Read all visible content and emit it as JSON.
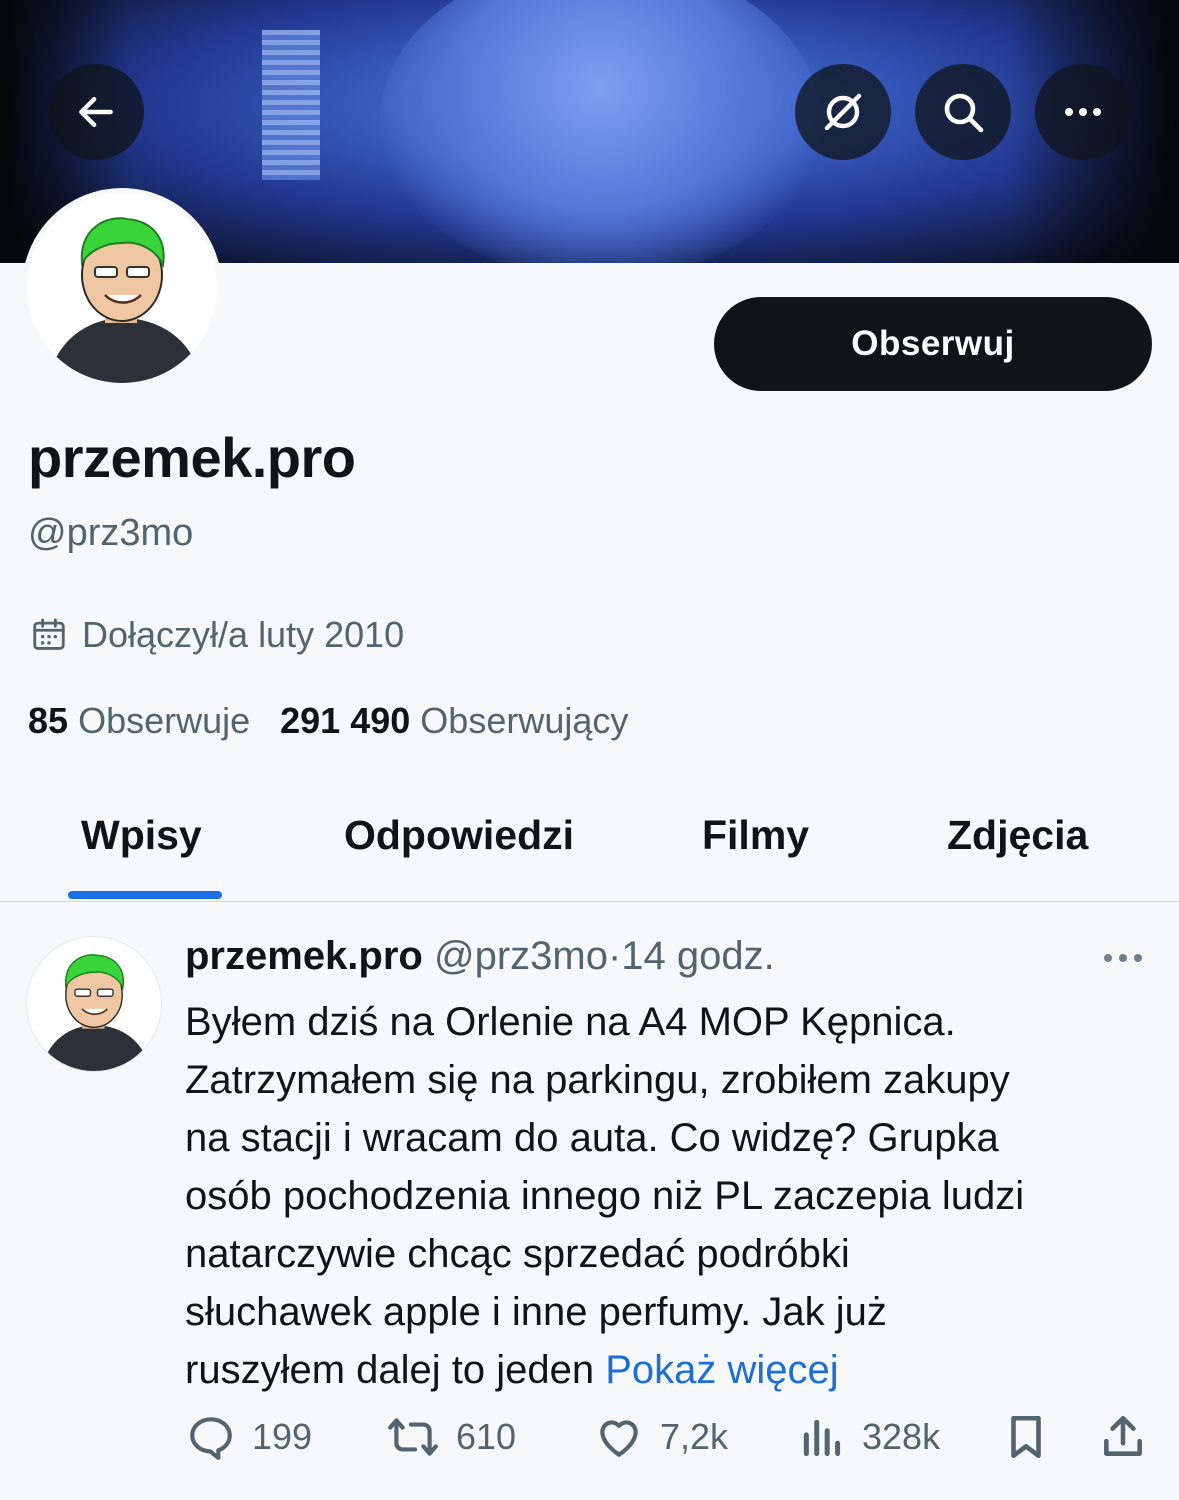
{
  "header": {
    "back_icon": "arrow-left-icon",
    "grok_icon": "grok-icon",
    "search_icon": "search-icon",
    "more_icon": "more-horizontal-icon"
  },
  "profile": {
    "display_name": "przemek.pro",
    "handle": "@prz3mo",
    "follow_label": "Obserwuj",
    "joined": "Dołączył/a luty 2010",
    "following_count": "85",
    "following_label": "Obserwuje",
    "followers_count": "291 490",
    "followers_label": "Obserwujący"
  },
  "tabs": [
    {
      "label": "Wpisy",
      "active": true
    },
    {
      "label": "Odpowiedzi",
      "active": false
    },
    {
      "label": "Filmy",
      "active": false
    },
    {
      "label": "Zdjęcia",
      "active": false
    }
  ],
  "tweet": {
    "name": "przemek.pro",
    "handle": "@prz3mo",
    "sep": "·",
    "time": "14 godz.",
    "lines": [
      "Byłem dziś na Orlenie na A4 MOP Kępnica.",
      "Zatrzymałem się na parkingu, zrobiłem zakupy",
      "na stacji i wracam do auta. Co widzę? Grupka",
      "osób pochodzenia innego niż PL zaczepia ludzi",
      "natarczywie chcąc sprzedać podróbki",
      "słuchawek apple i inne perfumy. Jak już",
      "ruszyłem dalej to jeden"
    ],
    "show_more": "Pokaż więcej",
    "replies": "199",
    "reposts": "610",
    "likes": "7,2k",
    "views": "328k"
  },
  "colors": {
    "accent": "#1d6fe8",
    "link": "#1d6fd8",
    "text": "#0f1419",
    "muted": "#536471"
  }
}
